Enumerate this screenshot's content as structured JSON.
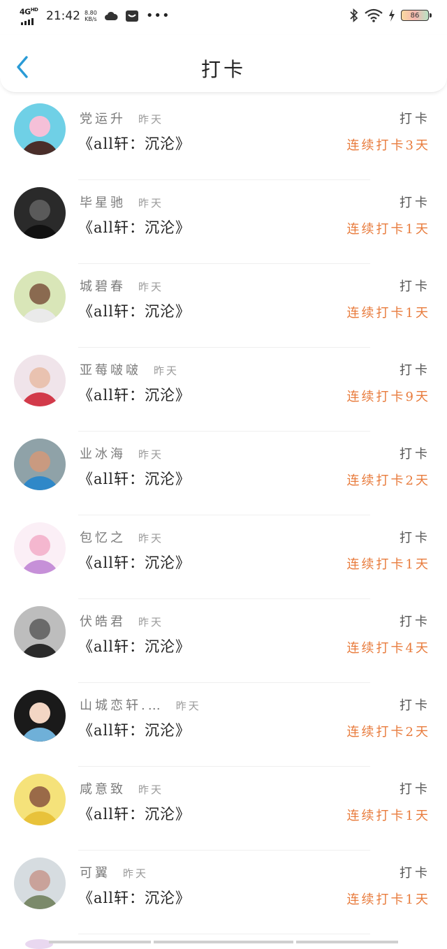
{
  "status_bar": {
    "network": "4G",
    "network_sup": "HD",
    "time": "21:42",
    "speed_value": "8.80",
    "speed_unit": "KB/s",
    "battery": "86"
  },
  "header": {
    "title": "打卡"
  },
  "rows": [
    {
      "name": "党运升",
      "time": "昨天",
      "book": "《all轩：沉沦》",
      "action": "打卡",
      "streak": "连续打卡3天",
      "avatar_colors": [
        "#6fd0e6",
        "#f5c0d8",
        "#4a2e2a"
      ]
    },
    {
      "name": "毕星驰",
      "time": "昨天",
      "book": "《all轩：沉沦》",
      "action": "打卡",
      "streak": "连续打卡1天",
      "avatar_colors": [
        "#2a2a2a",
        "#5a5a5a",
        "#111111"
      ]
    },
    {
      "name": "城碧春",
      "time": "昨天",
      "book": "《all轩：沉沦》",
      "action": "打卡",
      "streak": "连续打卡1天",
      "avatar_colors": [
        "#d9e6b8",
        "#8a6a50",
        "#eaeaea"
      ]
    },
    {
      "name": "亚莓啵啵",
      "time": "昨天",
      "book": "《all轩：沉沦》",
      "action": "打卡",
      "streak": "连续打卡9天",
      "avatar_colors": [
        "#f0e4ea",
        "#e9c2b0",
        "#d23a4a"
      ]
    },
    {
      "name": "业冰海",
      "time": "昨天",
      "book": "《all轩：沉沦》",
      "action": "打卡",
      "streak": "连续打卡2天",
      "avatar_colors": [
        "#8fa2a8",
        "#c99a80",
        "#2f88c8"
      ]
    },
    {
      "name": "包忆之",
      "time": "昨天",
      "book": "《all轩：沉沦》",
      "action": "打卡",
      "streak": "连续打卡1天",
      "avatar_colors": [
        "#fbeff6",
        "#f4b7cf",
        "#c690d8"
      ]
    },
    {
      "name": "伏皓君",
      "time": "昨天",
      "book": "《all轩：沉沦》",
      "action": "打卡",
      "streak": "连续打卡4天",
      "avatar_colors": [
        "#bdbdbd",
        "#6a6a6a",
        "#2b2b2b"
      ]
    },
    {
      "name": "山城恋轩.…",
      "time": "昨天",
      "book": "《all轩：沉沦》",
      "action": "打卡",
      "streak": "连续打卡2天",
      "avatar_colors": [
        "#1a1a1a",
        "#f3d6c4",
        "#6fb0d8"
      ]
    },
    {
      "name": "咸意致",
      "time": "昨天",
      "book": "《all轩：沉沦》",
      "action": "打卡",
      "streak": "连续打卡1天",
      "avatar_colors": [
        "#f5e27a",
        "#9a6a48",
        "#e8c23a"
      ]
    },
    {
      "name": "可翼",
      "time": "昨天",
      "book": "《all轩：沉沦》",
      "action": "打卡",
      "streak": "连续打卡1天",
      "avatar_colors": [
        "#d6dce0",
        "#c9a29a",
        "#7b8a6a"
      ]
    }
  ]
}
